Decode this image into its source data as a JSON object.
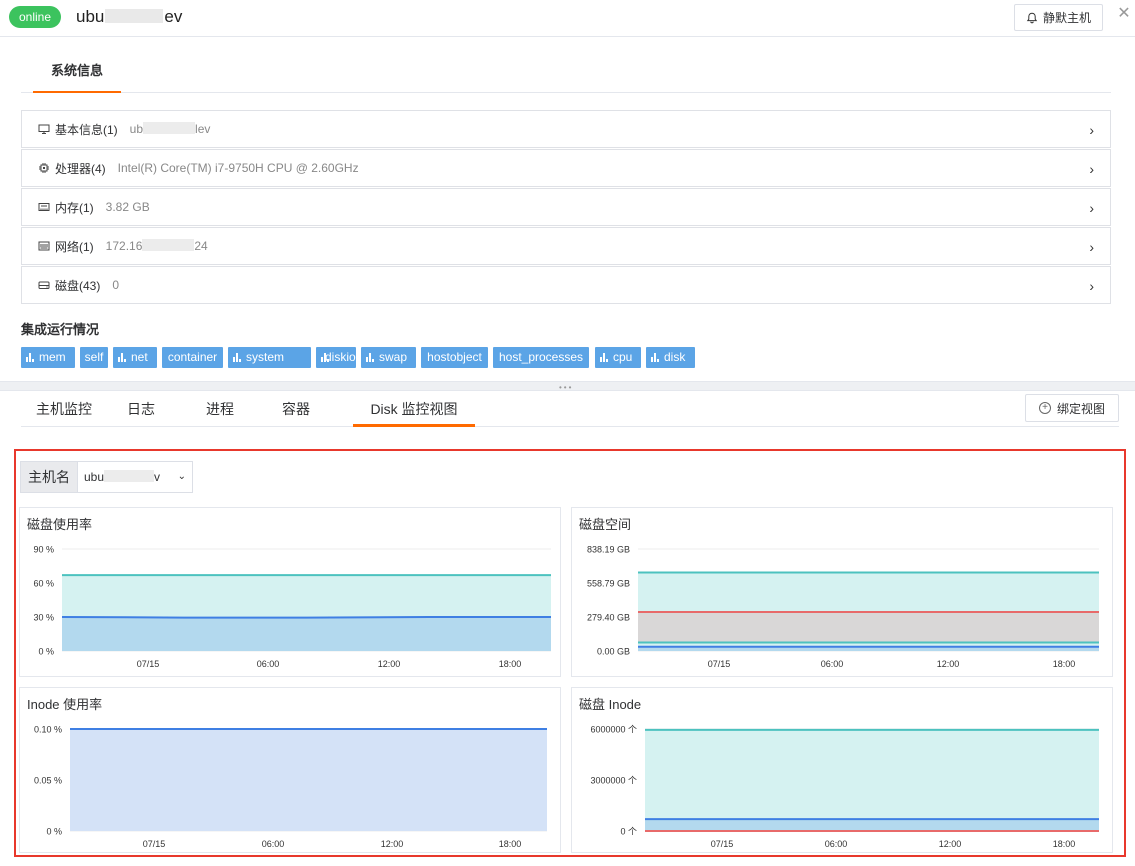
{
  "header": {
    "status": "online",
    "host_prefix": "ubu",
    "host_suffix": "ev",
    "mute_label": "静默主机",
    "close_glyph": "✕"
  },
  "sys_tab": "系统信息",
  "info_rows": [
    {
      "icon": "monitor-icon",
      "label": "基本信息(1)",
      "value_prefix": "ub",
      "value_suffix": "lev",
      "masked": true
    },
    {
      "icon": "cpu-icon",
      "label": "处理器(4)",
      "value_prefix": "Intel(R) Core(TM) i7-9750H CPU @ 2.60GHz",
      "value_suffix": "",
      "masked": false
    },
    {
      "icon": "memory-icon",
      "label": "内存(1)",
      "value_prefix": "3.82 GB",
      "value_suffix": "",
      "masked": false
    },
    {
      "icon": "network-icon",
      "label": "网络(1)",
      "value_prefix": "172.16",
      "value_suffix": "24",
      "masked": true
    },
    {
      "icon": "disk-icon",
      "label": "磁盘(43)",
      "value_prefix": "0",
      "value_suffix": "",
      "masked": false
    }
  ],
  "integration_title": "集成运行情况",
  "tags": [
    {
      "label": "mem",
      "icon": true
    },
    {
      "label": "self",
      "icon": false
    },
    {
      "label": "net",
      "icon": true
    },
    {
      "label": "container",
      "icon": false
    },
    {
      "label": "system",
      "icon": true
    },
    {
      "label": "diskio",
      "icon": true
    },
    {
      "label": "swap",
      "icon": true
    },
    {
      "label": "hostobject",
      "icon": false
    },
    {
      "label": "host_processes",
      "icon": false
    },
    {
      "label": "cpu",
      "icon": true
    },
    {
      "label": "disk",
      "icon": true
    }
  ],
  "monitor_tabs": [
    {
      "label": "主机监控",
      "active": false
    },
    {
      "label": "日志",
      "active": false
    },
    {
      "label": "进程",
      "active": false
    },
    {
      "label": "容器",
      "active": false
    },
    {
      "label": "Disk 监控视图",
      "active": true
    }
  ],
  "bind_view_label": "绑定视图",
  "filter": {
    "label": "主机名",
    "value_prefix": "ubu",
    "value_suffix": "v"
  },
  "colors": {
    "accent": "#ff6a00",
    "online": "#3cc35e",
    "tag": "#5ba4e6",
    "frame": "#e8382c",
    "teal": "#4cc2bf",
    "teal_fill": "#d5f2f1",
    "blue": "#3f7fe3",
    "blue_fill": "#b3d9ee",
    "red": "#e86a6a",
    "gray_fill": "#d9d7d7",
    "lav_fill": "#d4e2f7"
  },
  "chart_data": [
    {
      "type": "area",
      "title": "磁盘使用率",
      "y_ticks": [
        "90 %",
        "60 %",
        "30 %",
        "0 %"
      ],
      "ylim": [
        0,
        90
      ],
      "x_ticks": [
        "07/15",
        "06:00",
        "12:00",
        "18:00"
      ],
      "series": [
        {
          "values": [
            67,
            67
          ],
          "color": "teal"
        },
        {
          "values": [
            30,
            29.5,
            29.5,
            30,
            30
          ],
          "color": "blue"
        }
      ]
    },
    {
      "type": "area",
      "title": "磁盘空间",
      "y_ticks": [
        "838.19 GB",
        "558.79 GB",
        "279.40 GB",
        "0.00 GB"
      ],
      "ylim": [
        0,
        838.19
      ],
      "x_ticks": [
        "07/15",
        "06:00",
        "12:00",
        "18:00"
      ],
      "series": [
        {
          "values": [
            645,
            645
          ],
          "color": "teal"
        },
        {
          "values": [
            320,
            320
          ],
          "color": "red"
        },
        {
          "values": [
            70,
            70
          ],
          "color": "teal"
        },
        {
          "values": [
            35,
            35
          ],
          "color": "blue"
        }
      ]
    },
    {
      "type": "area",
      "title": "Inode 使用率",
      "y_ticks": [
        "0.10 %",
        "0.05 %",
        "0 %"
      ],
      "ylim": [
        0,
        0.1
      ],
      "x_ticks": [
        "07/15",
        "06:00",
        "12:00",
        "18:00"
      ],
      "series": [
        {
          "values": [
            0.1,
            0.1
          ],
          "color": "blue"
        }
      ]
    },
    {
      "type": "area",
      "title": "磁盘 Inode",
      "y_ticks": [
        "6000000 个",
        "3000000 个",
        "0 个"
      ],
      "ylim": [
        0,
        6000000
      ],
      "x_ticks": [
        "07/15",
        "06:00",
        "12:00",
        "18:00"
      ],
      "series": [
        {
          "values": [
            5950000,
            5950000
          ],
          "color": "teal"
        },
        {
          "values": [
            700000,
            700000
          ],
          "color": "blue"
        },
        {
          "values": [
            0,
            0
          ],
          "color": "red"
        }
      ]
    }
  ]
}
